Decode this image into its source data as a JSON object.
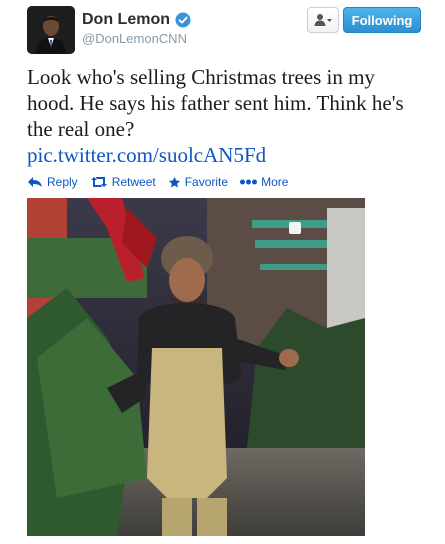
{
  "tweet": {
    "display_name": "Don Lemon",
    "handle": "@DonLemonCNN",
    "text": "Look who's selling Christmas trees in my hood. He says his father sent him. Think he's the real one?",
    "link": "pic.twitter.com/suolcAN5Fd"
  },
  "controls": {
    "follow_label": "Following"
  },
  "actions": {
    "reply": "Reply",
    "retweet": "Retweet",
    "favorite": "Favorite",
    "more": "More"
  },
  "colors": {
    "link": "#0c56c4",
    "follow_bg": "#2b8fd3",
    "verified": "#3b94d9"
  },
  "icons": [
    "user-dropdown-icon",
    "verified-badge-icon",
    "reply-icon",
    "retweet-icon",
    "favorite-star-icon",
    "more-dots-icon"
  ]
}
